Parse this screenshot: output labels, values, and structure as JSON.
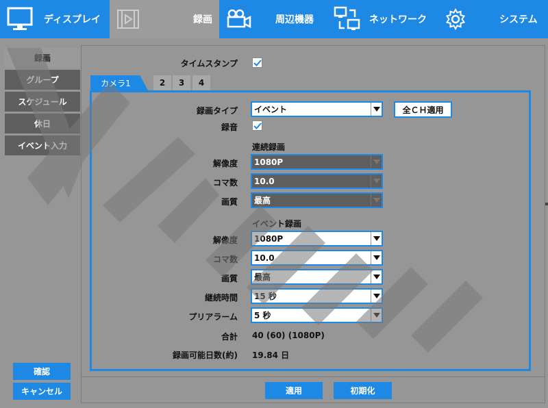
{
  "nav": {
    "tabs": [
      {
        "label": "ディスプレイ",
        "icon": "monitor-icon"
      },
      {
        "label": "録画",
        "icon": "film-icon"
      },
      {
        "label": "周辺機器",
        "icon": "camera-icon"
      },
      {
        "label": "ネットワーク",
        "icon": "network-icon"
      },
      {
        "label": "システム",
        "icon": "gear-icon"
      }
    ]
  },
  "sidebar": {
    "items": [
      {
        "label": "録画"
      },
      {
        "label": "グループ"
      },
      {
        "label": "スケジュール"
      },
      {
        "label": "休日"
      },
      {
        "label": "イベント入力"
      }
    ],
    "confirm_label": "確認",
    "cancel_label": "キャンセル"
  },
  "timestamp": {
    "label": "タイムスタンプ",
    "checked": true
  },
  "camera_tabs": [
    "カメラ1",
    "2",
    "3",
    "4"
  ],
  "record_type": {
    "label": "録画タイプ",
    "value": "イベント",
    "apply_all_label": "全ＣＨ適用"
  },
  "audio": {
    "label": "録音",
    "checked": true
  },
  "continuous": {
    "header": "連続録画",
    "resolution": {
      "label": "解像度",
      "value": "1080P"
    },
    "fps": {
      "label": "コマ数",
      "value": "10.0"
    },
    "quality": {
      "label": "画質",
      "value": "最高"
    }
  },
  "event": {
    "header": "イベント録画",
    "resolution": {
      "label": "解像度",
      "value": "1080P"
    },
    "fps": {
      "label": "コマ数",
      "value": "10.0"
    },
    "quality": {
      "label": "画質",
      "value": "最高"
    },
    "duration": {
      "label": "継続時間",
      "value": "15 秒"
    },
    "prealarm": {
      "label": "プリアラーム",
      "value": "5 秒"
    }
  },
  "total": {
    "label": "合計",
    "value": "40 (60) (1080P)"
  },
  "days": {
    "label": "録画可能日数(約)",
    "value": "19.84 日"
  },
  "footer": {
    "apply_label": "適用",
    "reset_label": "初期化"
  },
  "colors": {
    "accent": "#1e88e5",
    "background": "#969696"
  }
}
